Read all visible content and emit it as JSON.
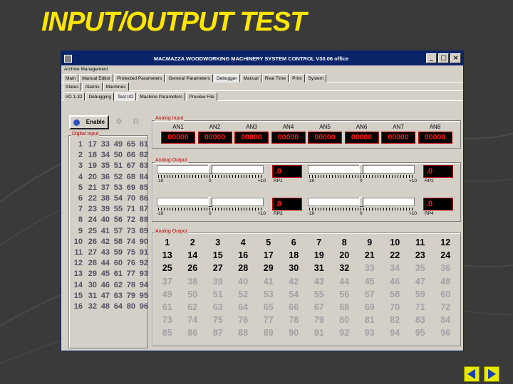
{
  "slide": {
    "title": "INPUT/OUTPUT TEST"
  },
  "window": {
    "title": "MACMAZZA WOODWORKING MACHINERY SYSTEM CONTROL  V30.06 office",
    "buttons": [
      "_",
      "□",
      "×"
    ]
  },
  "menubar": {
    "label": "Archive Management"
  },
  "tabs_row1": [
    "Main",
    "Manual Editor",
    "Protected Parameters",
    "General Parameters",
    "Debugger",
    "Manual",
    "Real Time",
    "Print",
    "System"
  ],
  "tabs_row2": [
    "Status",
    "Alarms",
    "Machines"
  ],
  "tabs_row3": [
    "I/O 1-32",
    "Debugging",
    "Test I/O",
    "Machine Parameters",
    "Preview File"
  ],
  "toolbar": {
    "enable_label": "Enable",
    "x_label": "R"
  },
  "digital_input": {
    "label": "Digital Input",
    "rows": [
      [
        "1",
        "17",
        "33",
        "49",
        "65",
        "81"
      ],
      [
        "2",
        "18",
        "34",
        "50",
        "66",
        "82"
      ],
      [
        "3",
        "19",
        "35",
        "51",
        "67",
        "83"
      ],
      [
        "4",
        "20",
        "36",
        "52",
        "68",
        "84"
      ],
      [
        "5",
        "21",
        "37",
        "53",
        "69",
        "85"
      ],
      [
        "6",
        "22",
        "38",
        "54",
        "70",
        "86"
      ],
      [
        "7",
        "23",
        "39",
        "55",
        "71",
        "87"
      ],
      [
        "8",
        "24",
        "40",
        "56",
        "72",
        "88"
      ],
      [
        "9",
        "25",
        "41",
        "57",
        "73",
        "89"
      ],
      [
        "10",
        "26",
        "42",
        "58",
        "74",
        "90"
      ],
      [
        "11",
        "27",
        "43",
        "59",
        "75",
        "91"
      ],
      [
        "12",
        "28",
        "44",
        "60",
        "76",
        "92"
      ],
      [
        "13",
        "29",
        "45",
        "61",
        "77",
        "93"
      ],
      [
        "14",
        "30",
        "46",
        "62",
        "78",
        "94"
      ],
      [
        "15",
        "31",
        "47",
        "63",
        "79",
        "95"
      ],
      [
        "16",
        "32",
        "48",
        "64",
        "80",
        "96"
      ]
    ]
  },
  "analog_input": {
    "label": "Analog Input",
    "channels": [
      {
        "name": "AN1",
        "value": "00000"
      },
      {
        "name": "AN2",
        "value": "00000"
      },
      {
        "name": "AN3",
        "value": "00000"
      },
      {
        "name": "AN4",
        "value": "00000"
      },
      {
        "name": "AN5",
        "value": "00000"
      },
      {
        "name": "AN6",
        "value": "00000"
      },
      {
        "name": "AN7",
        "value": "00000"
      },
      {
        "name": "AN8",
        "value": "00000"
      }
    ]
  },
  "analog_output": {
    "label": "Analog Output",
    "controls": [
      {
        "min": "-10",
        "mid": "0",
        "max": "+10",
        "name": "RP1",
        "value": ".0",
        "level": 0.5
      },
      {
        "min": "-10",
        "mid": "0",
        "max": "+10",
        "name": "RP2",
        "value": ".0",
        "level": 0.5
      },
      {
        "min": "-10",
        "mid": "0",
        "max": "+10",
        "name": "RP3",
        "value": ".0",
        "level": 0.5
      },
      {
        "min": "-10",
        "mid": "0",
        "max": "+10",
        "name": "RP4",
        "value": ".0",
        "level": 0.5
      }
    ]
  },
  "digital_output": {
    "label": "Analog Output",
    "rows": [
      [
        "1",
        "2",
        "3",
        "4",
        "5",
        "6",
        "7",
        "8",
        "9",
        "10",
        "11",
        "12"
      ],
      [
        "13",
        "14",
        "15",
        "16",
        "17",
        "18",
        "19",
        "20",
        "21",
        "22",
        "23",
        "24"
      ],
      [
        "25",
        "26",
        "27",
        "28",
        "29",
        "30",
        "31",
        "32",
        "33",
        "34",
        "35",
        "36"
      ],
      [
        "37",
        "38",
        "39",
        "40",
        "41",
        "42",
        "43",
        "44",
        "45",
        "46",
        "47",
        "48"
      ],
      [
        "49",
        "50",
        "51",
        "52",
        "53",
        "54",
        "55",
        "56",
        "57",
        "58",
        "59",
        "60"
      ],
      [
        "61",
        "62",
        "63",
        "64",
        "65",
        "66",
        "67",
        "68",
        "69",
        "70",
        "71",
        "72"
      ],
      [
        "73",
        "74",
        "75",
        "76",
        "77",
        "78",
        "79",
        "80",
        "81",
        "82",
        "83",
        "84"
      ],
      [
        "85",
        "86",
        "87",
        "88",
        "89",
        "90",
        "91",
        "92",
        "93",
        "94",
        "95",
        "96"
      ]
    ],
    "active": [
      [
        1,
        1,
        1,
        1,
        1,
        1,
        1,
        1,
        1,
        1,
        1,
        1
      ],
      [
        1,
        1,
        1,
        1,
        1,
        1,
        1,
        1,
        1,
        1,
        1,
        1
      ],
      [
        1,
        1,
        1,
        1,
        1,
        1,
        1,
        1,
        0,
        0,
        0,
        0
      ],
      [
        0,
        0,
        0,
        0,
        0,
        0,
        0,
        0,
        0,
        0,
        0,
        0
      ],
      [
        0,
        0,
        0,
        0,
        0,
        0,
        0,
        0,
        0,
        0,
        0,
        0
      ],
      [
        0,
        0,
        0,
        0,
        0,
        0,
        0,
        0,
        0,
        0,
        0,
        0
      ],
      [
        0,
        0,
        0,
        0,
        0,
        0,
        0,
        0,
        0,
        0,
        0,
        0
      ],
      [
        0,
        0,
        0,
        0,
        0,
        0,
        0,
        0,
        0,
        0,
        0,
        0
      ]
    ]
  },
  "nav": {
    "colors": {
      "button": "#e8e800",
      "arrow": "#1a3fb0"
    }
  }
}
